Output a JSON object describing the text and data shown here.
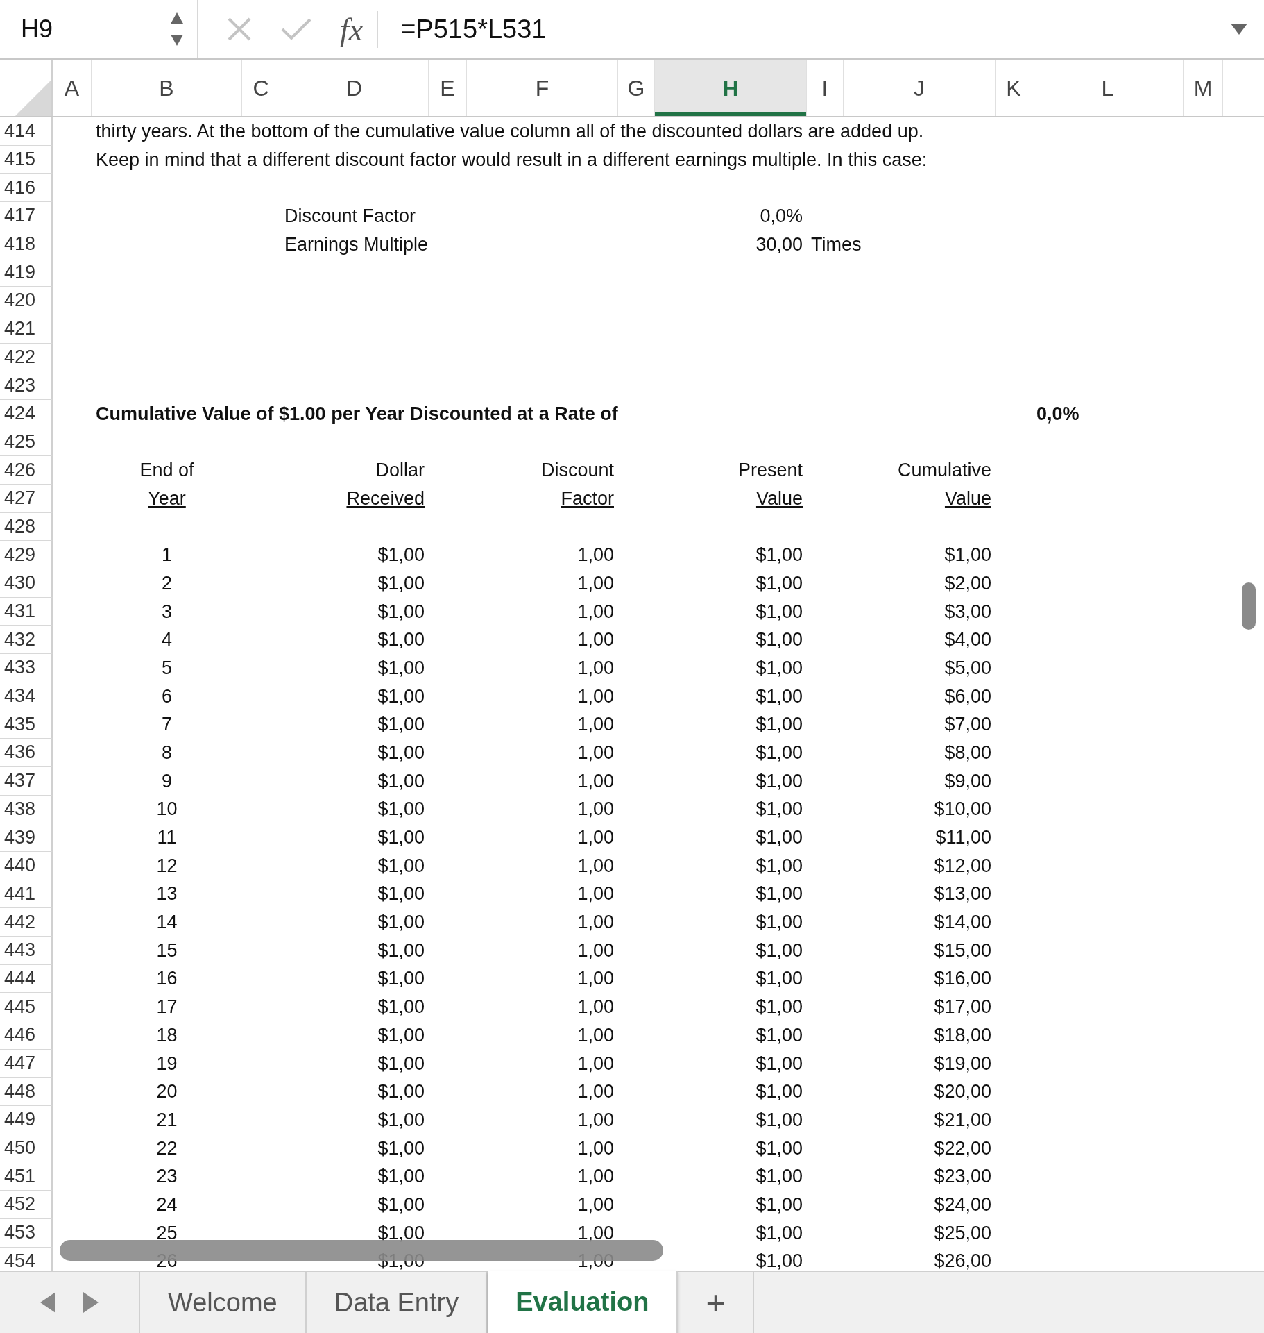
{
  "formula_bar": {
    "cell_name": "H9",
    "formula": "=P515*L531",
    "fx": "fx"
  },
  "columns": [
    {
      "label": "A",
      "selected": false
    },
    {
      "label": "B",
      "selected": false
    },
    {
      "label": "C",
      "selected": false
    },
    {
      "label": "D",
      "selected": false
    },
    {
      "label": "E",
      "selected": false
    },
    {
      "label": "F",
      "selected": false
    },
    {
      "label": "G",
      "selected": false
    },
    {
      "label": "H",
      "selected": true
    },
    {
      "label": "I",
      "selected": false
    },
    {
      "label": "J",
      "selected": false
    },
    {
      "label": "K",
      "selected": false
    },
    {
      "label": "L",
      "selected": false
    },
    {
      "label": "M",
      "selected": false
    }
  ],
  "rows": [
    {
      "number": "414",
      "kind": "text",
      "text": "thirty years.  At the bottom of the cumulative value column all of the discounted dollars are added up."
    },
    {
      "number": "415",
      "kind": "text",
      "text": "Keep in mind that a different discount factor would result in a different earnings multiple.  In this case:"
    },
    {
      "number": "416",
      "kind": "blank"
    },
    {
      "number": "417",
      "kind": "param",
      "label": "Discount Factor",
      "value": "0,0%"
    },
    {
      "number": "418",
      "kind": "param",
      "label": "Earnings Multiple",
      "value": "30,00",
      "unit": "Times"
    },
    {
      "number": "419",
      "kind": "blank"
    },
    {
      "number": "420",
      "kind": "blank"
    },
    {
      "number": "421",
      "kind": "blank"
    },
    {
      "number": "422",
      "kind": "blank"
    },
    {
      "number": "423",
      "kind": "blank"
    },
    {
      "number": "424",
      "kind": "title",
      "text": "Cumulative Value of $1.00 per Year Discounted at a Rate of",
      "value": "0,0%"
    },
    {
      "number": "425",
      "kind": "blank"
    },
    {
      "number": "426",
      "kind": "header",
      "cells": [
        "End of",
        "Dollar",
        "Discount",
        "Present",
        "Cumulative"
      ]
    },
    {
      "number": "427",
      "kind": "header_underlined",
      "cells": [
        "Year",
        "Received",
        "Factor",
        "Value",
        "Value"
      ]
    },
    {
      "number": "428",
      "kind": "blank"
    },
    {
      "number": "429",
      "kind": "data",
      "cells": [
        "1",
        "$1,00",
        "1,00",
        "$1,00",
        "$1,00"
      ]
    },
    {
      "number": "430",
      "kind": "data",
      "cells": [
        "2",
        "$1,00",
        "1,00",
        "$1,00",
        "$2,00"
      ]
    },
    {
      "number": "431",
      "kind": "data",
      "cells": [
        "3",
        "$1,00",
        "1,00",
        "$1,00",
        "$3,00"
      ]
    },
    {
      "number": "432",
      "kind": "data",
      "cells": [
        "4",
        "$1,00",
        "1,00",
        "$1,00",
        "$4,00"
      ]
    },
    {
      "number": "433",
      "kind": "data",
      "cells": [
        "5",
        "$1,00",
        "1,00",
        "$1,00",
        "$5,00"
      ]
    },
    {
      "number": "434",
      "kind": "data",
      "cells": [
        "6",
        "$1,00",
        "1,00",
        "$1,00",
        "$6,00"
      ]
    },
    {
      "number": "435",
      "kind": "data",
      "cells": [
        "7",
        "$1,00",
        "1,00",
        "$1,00",
        "$7,00"
      ]
    },
    {
      "number": "436",
      "kind": "data",
      "cells": [
        "8",
        "$1,00",
        "1,00",
        "$1,00",
        "$8,00"
      ]
    },
    {
      "number": "437",
      "kind": "data",
      "cells": [
        "9",
        "$1,00",
        "1,00",
        "$1,00",
        "$9,00"
      ]
    },
    {
      "number": "438",
      "kind": "data",
      "cells": [
        "10",
        "$1,00",
        "1,00",
        "$1,00",
        "$10,00"
      ]
    },
    {
      "number": "439",
      "kind": "data",
      "cells": [
        "11",
        "$1,00",
        "1,00",
        "$1,00",
        "$11,00"
      ]
    },
    {
      "number": "440",
      "kind": "data",
      "cells": [
        "12",
        "$1,00",
        "1,00",
        "$1,00",
        "$12,00"
      ]
    },
    {
      "number": "441",
      "kind": "data",
      "cells": [
        "13",
        "$1,00",
        "1,00",
        "$1,00",
        "$13,00"
      ]
    },
    {
      "number": "442",
      "kind": "data",
      "cells": [
        "14",
        "$1,00",
        "1,00",
        "$1,00",
        "$14,00"
      ]
    },
    {
      "number": "443",
      "kind": "data",
      "cells": [
        "15",
        "$1,00",
        "1,00",
        "$1,00",
        "$15,00"
      ]
    },
    {
      "number": "444",
      "kind": "data",
      "cells": [
        "16",
        "$1,00",
        "1,00",
        "$1,00",
        "$16,00"
      ]
    },
    {
      "number": "445",
      "kind": "data",
      "cells": [
        "17",
        "$1,00",
        "1,00",
        "$1,00",
        "$17,00"
      ]
    },
    {
      "number": "446",
      "kind": "data",
      "cells": [
        "18",
        "$1,00",
        "1,00",
        "$1,00",
        "$18,00"
      ]
    },
    {
      "number": "447",
      "kind": "data",
      "cells": [
        "19",
        "$1,00",
        "1,00",
        "$1,00",
        "$19,00"
      ]
    },
    {
      "number": "448",
      "kind": "data",
      "cells": [
        "20",
        "$1,00",
        "1,00",
        "$1,00",
        "$20,00"
      ]
    },
    {
      "number": "449",
      "kind": "data",
      "cells": [
        "21",
        "$1,00",
        "1,00",
        "$1,00",
        "$21,00"
      ]
    },
    {
      "number": "450",
      "kind": "data",
      "cells": [
        "22",
        "$1,00",
        "1,00",
        "$1,00",
        "$22,00"
      ]
    },
    {
      "number": "451",
      "kind": "data",
      "cells": [
        "23",
        "$1,00",
        "1,00",
        "$1,00",
        "$23,00"
      ]
    },
    {
      "number": "452",
      "kind": "data",
      "cells": [
        "24",
        "$1,00",
        "1,00",
        "$1,00",
        "$24,00"
      ]
    },
    {
      "number": "453",
      "kind": "data",
      "cells": [
        "25",
        "$1,00",
        "1,00",
        "$1,00",
        "$25,00"
      ]
    },
    {
      "number": "454",
      "kind": "data",
      "cells": [
        "26",
        "$1,00",
        "1,00",
        "$1,00",
        "$26,00"
      ]
    }
  ],
  "sheet_tabs": [
    {
      "label": "Welcome",
      "selected": false
    },
    {
      "label": "Data Entry",
      "selected": false
    },
    {
      "label": "Evaluation",
      "selected": true
    }
  ],
  "add_sheet": "+"
}
